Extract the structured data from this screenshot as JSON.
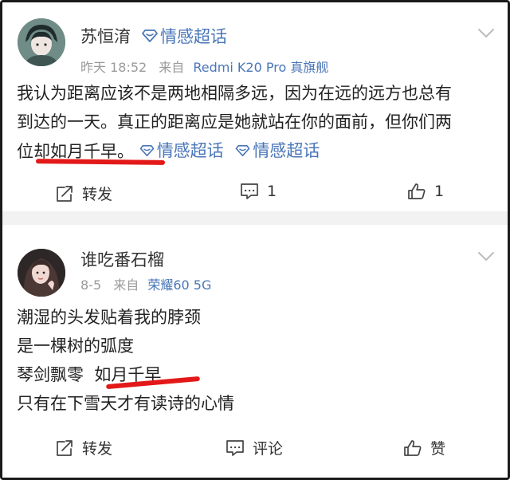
{
  "post1": {
    "username": "苏恒淯",
    "topic_tag": "情感超话",
    "time": "昨天 18:52",
    "from_label": "来自",
    "device": "Redmi K20 Pro 真旗舰",
    "lines": [
      "我认为距离应该不是两地相隔多远，因为在远的远方也总有",
      "到达的一天。真正的距离应是她就站在你的面前，但你们两"
    ],
    "line3_text": "位却如月千早。",
    "inline_tags": [
      "情感超话",
      "情感超话"
    ],
    "actions": {
      "repost": "转发",
      "comment_count": "1",
      "like_count": "1"
    }
  },
  "post2": {
    "username": "谁吃番石榴",
    "time": "8-5",
    "from_label": "来自",
    "device": "荣耀60 5G",
    "lines": [
      "潮湿的头发贴着我的脖颈",
      "是一棵树的弧度",
      "琴剑飘零  如月千早",
      "只有在下雪天才有读诗的心情"
    ],
    "actions": {
      "repost": "转发",
      "comment": "评论",
      "like": "赞"
    }
  },
  "icons": {
    "topic": "diamond-topic-icon",
    "repost": "share-icon",
    "comment": "comment-icon",
    "like": "thumbs-up-icon",
    "menu": "chevron-down-icon"
  },
  "colors": {
    "link_blue": "#4a76b8",
    "meta_gray": "#9a9a9a",
    "underline_red": "#e31919",
    "separator": "#f2f2f2"
  }
}
